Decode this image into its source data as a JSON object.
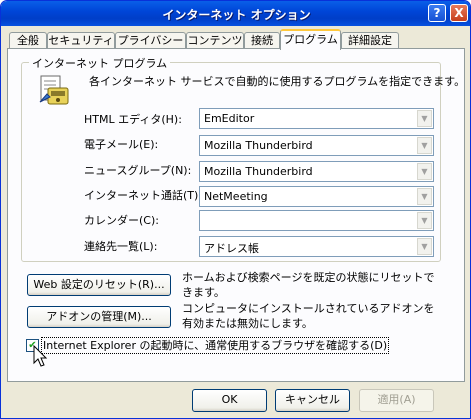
{
  "window": {
    "title": "インターネット オプション",
    "help_label": "?",
    "close_label": "X"
  },
  "tabs": [
    {
      "label": "全般"
    },
    {
      "label": "セキュリティ"
    },
    {
      "label": "プライバシー"
    },
    {
      "label": "コンテンツ"
    },
    {
      "label": "接続"
    },
    {
      "label": "プログラム"
    },
    {
      "label": "詳細設定"
    }
  ],
  "active_tab": "プログラム",
  "programs": {
    "group_label": "インターネット プログラム",
    "description": "各インターネット サービスで自動的に使用するプログラムを指定できます。",
    "rows": [
      {
        "label": "HTML エディタ(H):",
        "value": "EmEditor"
      },
      {
        "label": "電子メール(E):",
        "value": "Mozilla Thunderbird"
      },
      {
        "label": "ニュースグループ(N):",
        "value": "Mozilla Thunderbird"
      },
      {
        "label": "インターネット通話(T):",
        "value": "NetMeeting"
      },
      {
        "label": "カレンダー(C):",
        "value": ""
      },
      {
        "label": "連絡先一覧(L):",
        "value": "アドレス帳"
      }
    ]
  },
  "actions": {
    "reset_web_label": "Web 設定のリセット(R)...",
    "reset_web_desc": "ホームおよび検索ページを既定の状態にリセットできます。",
    "addons_label": "アドオンの管理(M)...",
    "addons_desc": "コンピュータにインストールされているアドオンを有効または無効にします。"
  },
  "checkbox": {
    "label": "Internet Explorer の起動時に、通常使用するブラウザを確認する(D)",
    "checked": true,
    "check_glyph": "✔"
  },
  "footer": {
    "ok_label": "OK",
    "cancel_label": "キャンセル",
    "apply_label": "適用(A)"
  }
}
